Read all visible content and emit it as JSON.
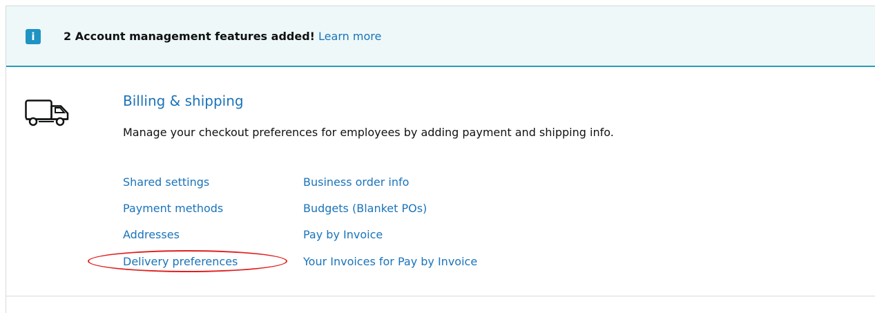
{
  "banner": {
    "count": "2",
    "message": "Account management features added!",
    "link_label": "Learn more",
    "icon": "info-icon"
  },
  "section": {
    "icon": "truck-icon",
    "title": "Billing & shipping",
    "description": "Manage your checkout preferences for employees by adding payment and shipping info.",
    "links_col1": [
      "Shared settings",
      "Payment methods",
      "Addresses",
      "Delivery preferences"
    ],
    "links_col2": [
      "Business order info",
      "Budgets (Blanket POs)",
      "Pay by Invoice",
      "Your Invoices for Pay by Invoice"
    ]
  },
  "colors": {
    "link": "#1a73ba",
    "banner_bg": "#eef8f9",
    "banner_border": "#2a9ab4",
    "info_badge": "#1f93c4",
    "highlight": "#e01f1f"
  }
}
